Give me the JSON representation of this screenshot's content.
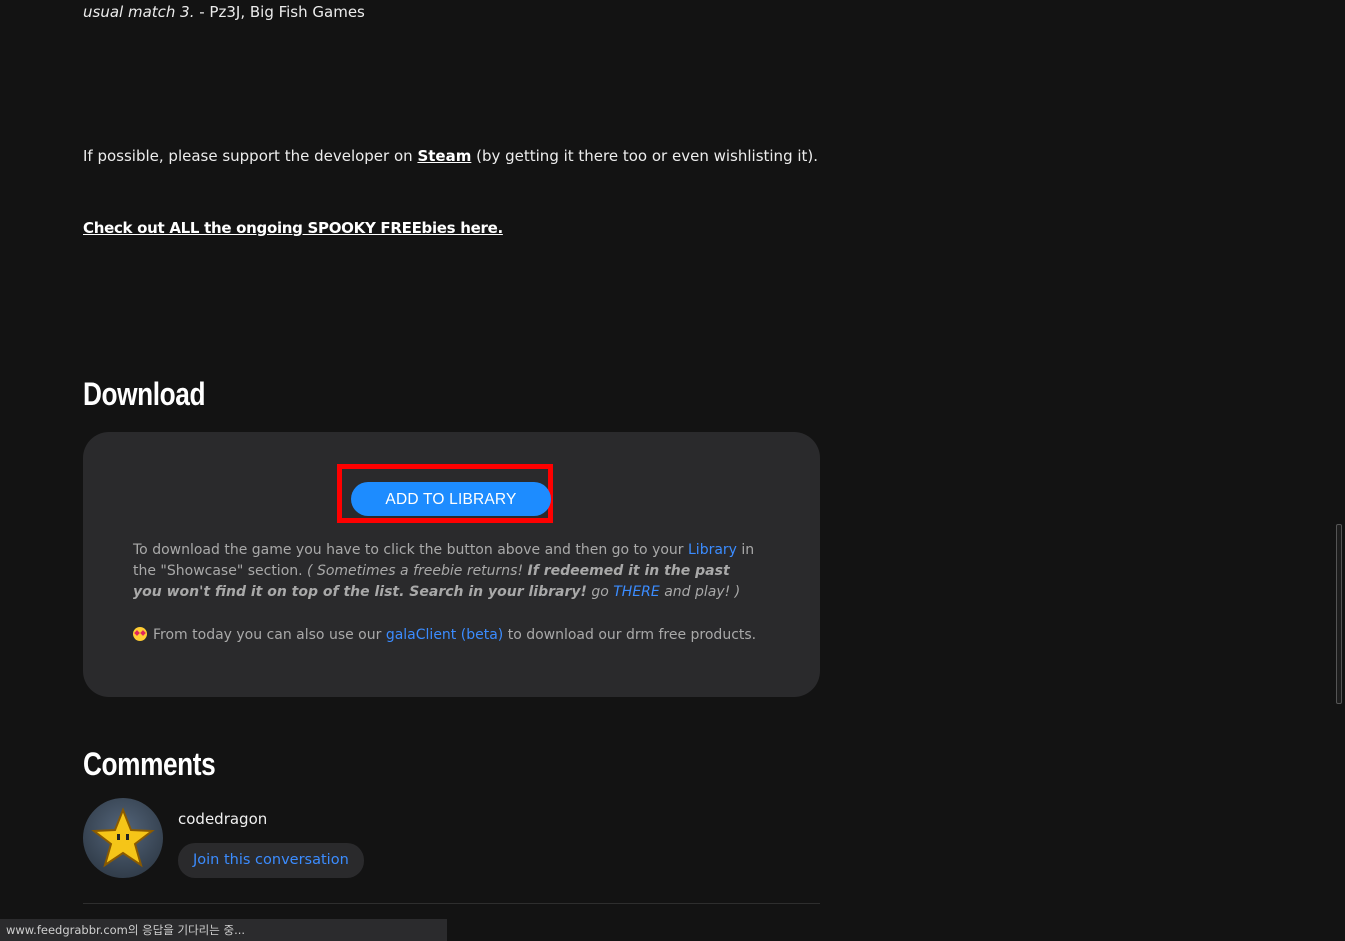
{
  "article": {
    "quote_italic": "usual match 3.",
    "quote_attribution": " - Pz3J, Big Fish Games",
    "support_prefix": "If possible, please support the developer on ",
    "support_link": "Steam",
    "support_suffix": " (by getting it there too or even wishlisting it).",
    "spooky_link": "Check out ALL the ongoing SPOOKY FREEbies here."
  },
  "download": {
    "title": "Download",
    "button_label": "ADD TO LIBRARY",
    "text_prefix": "To download the game you have to click the button above and then go to your ",
    "library_link": "Library",
    "text_middle": " in the \"Showcase\" section. ",
    "italic_a": "( Sometimes a freebie returns! ",
    "bold_italic": "If redeemed it in the past you won't find it on top of the list. Search in your library!",
    "italic_b": " go ",
    "there_link": "THERE",
    "italic_c": " and play! )",
    "client_prefix": "From today you can also use our ",
    "client_link": "galaClient (beta)",
    "client_suffix": " to download our drm free products.",
    "emoji_icon": "star-struck-emoji-icon"
  },
  "comments": {
    "title": "Comments",
    "username": "codedragon",
    "join_label": "Join this conversation",
    "avatar_icon": "star-avatar-icon"
  },
  "status_bar": {
    "text": "www.feedgrabbr.com의 응답을 기다리는 중..."
  },
  "colors": {
    "background": "#131313",
    "panel": "#2a2a2c",
    "accent": "#1d8cff",
    "link": "#3b8cff",
    "highlight": "#ff0000"
  }
}
